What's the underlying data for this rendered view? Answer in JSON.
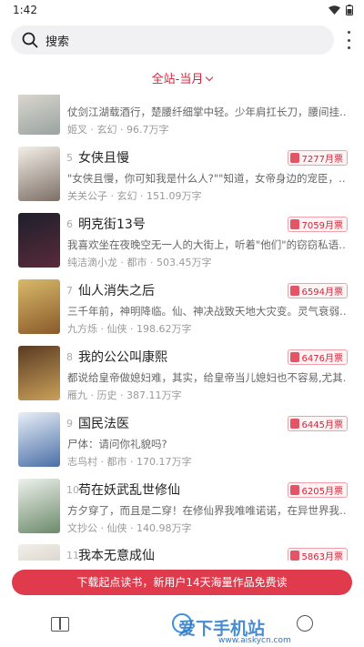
{
  "status_bar": {
    "time": "1:42"
  },
  "search": {
    "placeholder": "搜索"
  },
  "filter": {
    "label": "全站-当月"
  },
  "books": [
    {
      "rank": "",
      "title": "",
      "tickets": "",
      "desc": "仗剑江湖载酒行，楚腰纤细掌中轻。少年肩扛长刀，腰间挂…",
      "author": "姬叉",
      "genre": "玄幻",
      "words": "96.7万字",
      "cover": [
        "#e9e4db",
        "#9aa39f"
      ]
    },
    {
      "rank": "5",
      "title": "女侠且慢",
      "tickets": "7277月票",
      "desc": "\"女侠且慢，你可知我是什么人?\"\"知道，女帝身边的宠臣，…",
      "author": "关关公子",
      "genre": "玄幻",
      "words": "151.09万字",
      "cover": [
        "#f3efe8",
        "#7d6f66"
      ]
    },
    {
      "rank": "6",
      "title": "明克街13号",
      "tickets": "7059月票",
      "desc": "我喜欢坐在夜晚空无一人的大街上，听着\"他们\"的窃窃私语…",
      "author": "纯洁滴小龙",
      "genre": "都市",
      "words": "503.45万字",
      "cover": [
        "#1d1f2a",
        "#5a2a3a"
      ]
    },
    {
      "rank": "7",
      "title": "仙人消失之后",
      "tickets": "6594月票",
      "desc": "三千年前，神明降临。仙、神决战致天地大灾变。灵气衰弱…",
      "author": "九方烁",
      "genre": "仙侠",
      "words": "198.62万字",
      "cover": [
        "#d8b96a",
        "#8a5a2a"
      ]
    },
    {
      "rank": "8",
      "title": "我的公公叫康熙",
      "tickets": "6476月票",
      "desc": "都说给皇帝做媳妇难，其实，给皇帝当儿媳妇也不容易,尤其…",
      "author": "雁九",
      "genre": "历史",
      "words": "387.11万字",
      "cover": [
        "#5a3a22",
        "#c9a15a"
      ]
    },
    {
      "rank": "9",
      "title": "国民法医",
      "tickets": "6445月票",
      "desc": "尸体：请问你礼貌吗?",
      "author": "志鸟村",
      "genre": "都市",
      "words": "170.17万字",
      "cover": [
        "#e8eef6",
        "#4a6fa8"
      ]
    },
    {
      "rank": "10",
      "title": "苟在妖武乱世修仙",
      "tickets": "6205月票",
      "desc": "方夕穿了，而且是二穿！在修仙界我唯唯诺诺，在异世界我…",
      "author": "文抄公",
      "genre": "仙侠",
      "words": "140.98万字",
      "cover": [
        "#eef1ec",
        "#6b8a6a"
      ]
    },
    {
      "rank": "11",
      "title": "我本无意成仙",
      "tickets": "5863月票",
      "desc": "",
      "author": "",
      "genre": "",
      "words": "",
      "cover": [
        "#f2f0ec",
        "#c4b9a8"
      ]
    }
  ],
  "cta": {
    "label": "下载起点读书，新用户14天海量作品免费读"
  },
  "watermark": {
    "text": "爱下手机站",
    "url": "www.aiskycn.com"
  }
}
